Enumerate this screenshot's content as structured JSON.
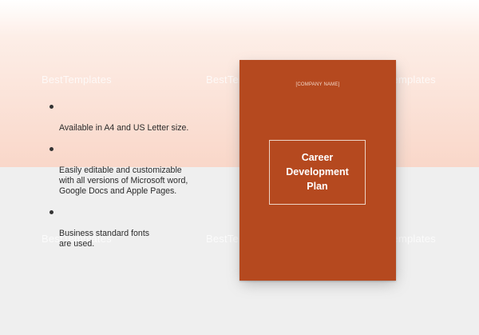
{
  "watermark": "BestTemplates",
  "features": [
    "Available in A4 and US Letter size.",
    "Easily editable and customizable\nwith all versions of Microsoft word,\nGoogle Docs and Apple Pages.",
    "Business standard fonts\nare used."
  ],
  "document": {
    "company_name": "[COMPANY NAME]",
    "title_lines": [
      "Career",
      "Development",
      "Plan"
    ]
  },
  "colors": {
    "cover": "#b5491f",
    "top_background": "#f9d7c9",
    "bottom_background": "#efefef"
  }
}
